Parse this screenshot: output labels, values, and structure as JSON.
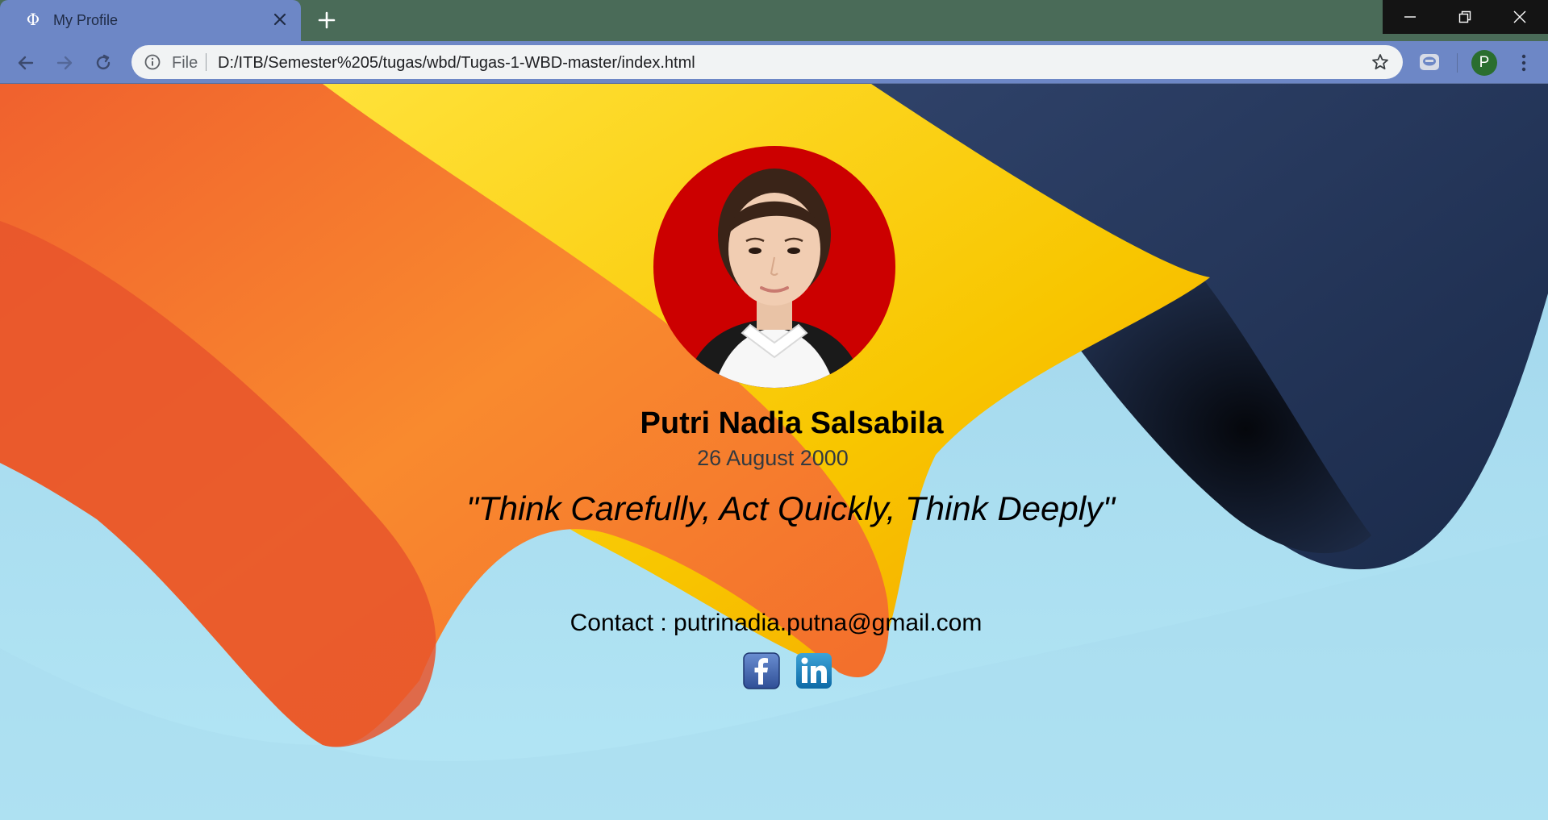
{
  "browser": {
    "tab": {
      "title": "My Profile",
      "favicon": "phi-icon"
    },
    "toolbar": {
      "scheme_label": "File",
      "url": "D:/ITB/Semester%205/tugas/wbd/Tugas-1-WBD-master/index.html",
      "profile_initial": "P"
    },
    "colors": {
      "tab_active": "#6d87c6",
      "tabstrip": "#4a6b58",
      "profile_avatar": "#2a6e2f"
    }
  },
  "page": {
    "name": "Putri Nadia Salsabila",
    "birth_date": "26 August 2000",
    "quote": "\"Think Carefully, Act Quickly, Think Deeply\"",
    "contact": "Contact : putrinadia.putna@gmail.com",
    "social": [
      {
        "name": "facebook",
        "icon": "facebook-icon",
        "label": "f"
      },
      {
        "name": "linkedin",
        "icon": "linkedin-icon",
        "label": "in"
      }
    ],
    "colors": {
      "photo_background": "#cc0000",
      "dob_text": "#333a40"
    }
  }
}
